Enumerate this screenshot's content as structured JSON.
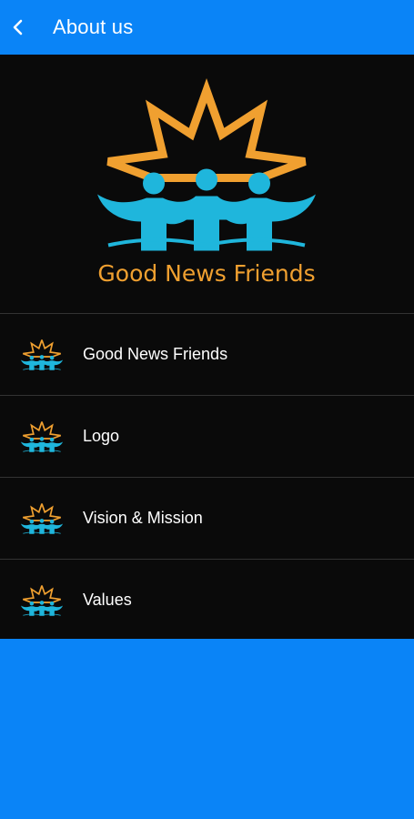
{
  "app_bar": {
    "back_icon": "chevron-left-icon",
    "title": "About us"
  },
  "hero": {
    "logo_text": "Good News Friends"
  },
  "menu": {
    "items": [
      {
        "label": "Good News Friends",
        "icon": "gnf-logo-icon"
      },
      {
        "label": "Logo",
        "icon": "gnf-logo-icon"
      },
      {
        "label": "Vision & Mission",
        "icon": "gnf-logo-icon"
      },
      {
        "label": "Values",
        "icon": "gnf-logo-icon"
      }
    ]
  },
  "colors": {
    "primary": "#0a84f7",
    "surface": "#0a0a0a",
    "logo_orange": "#f0a030",
    "logo_cyan": "#1fb6dc"
  }
}
